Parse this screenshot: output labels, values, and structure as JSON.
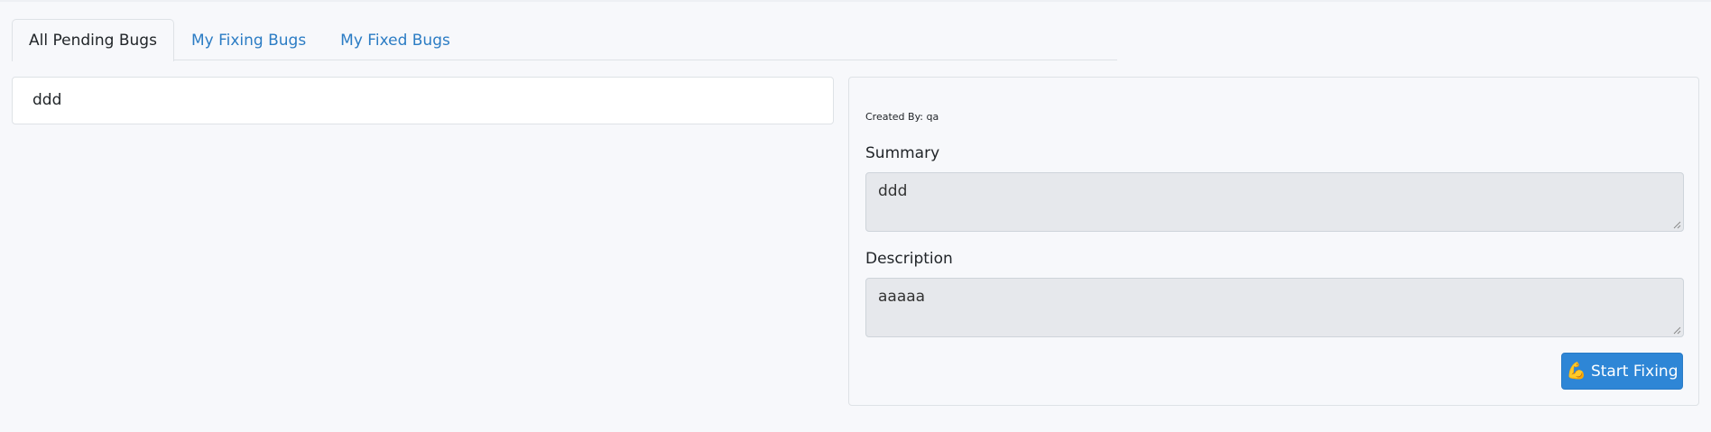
{
  "tabs": [
    {
      "label": "All Pending Bugs",
      "active": true
    },
    {
      "label": "My Fixing Bugs",
      "active": false
    },
    {
      "label": "My Fixed Bugs",
      "active": false
    }
  ],
  "bug_list": [
    {
      "title": "ddd"
    }
  ],
  "detail": {
    "created_by": "Created By: qa",
    "summary_label": "Summary",
    "summary_value": "ddd",
    "description_label": "Description",
    "description_value": "aaaaa",
    "start_button_icon": "💪",
    "start_button_label": "Start Fixing"
  },
  "colors": {
    "link": "#2b7cc4",
    "primary_button": "#2e86d6",
    "page_background": "#f7f8fb",
    "field_background": "#e6e8ec"
  }
}
